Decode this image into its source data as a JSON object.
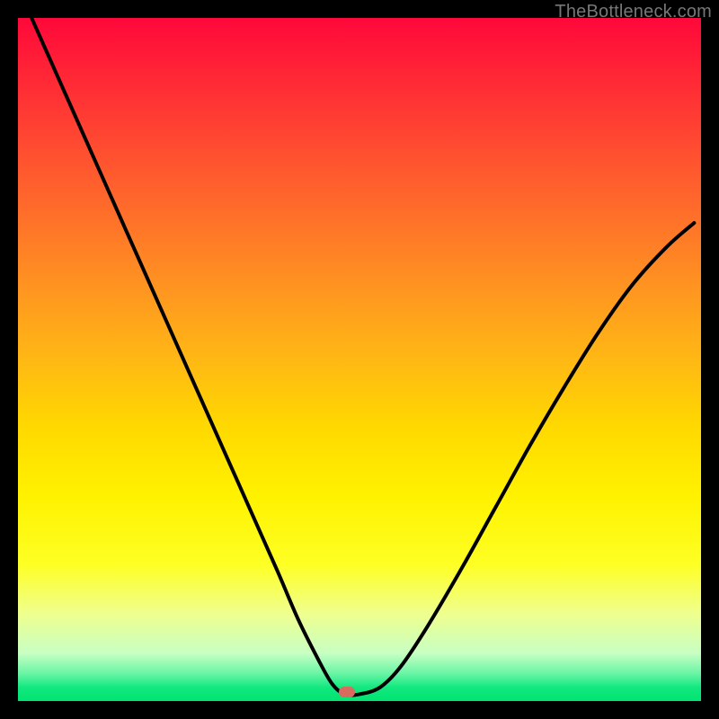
{
  "watermark": "TheBottleneck.com",
  "marker": {
    "x_frac": 0.481,
    "y_frac": 0.987
  },
  "chart_data": {
    "type": "line",
    "title": "",
    "xlabel": "",
    "ylabel": "",
    "xlim": [
      0,
      1
    ],
    "ylim": [
      0,
      1
    ],
    "series": [
      {
        "name": "bottleneck-curve",
        "x": [
          0.02,
          0.06,
          0.1,
          0.14,
          0.18,
          0.22,
          0.26,
          0.3,
          0.34,
          0.38,
          0.41,
          0.44,
          0.46,
          0.478,
          0.5,
          0.53,
          0.56,
          0.6,
          0.65,
          0.7,
          0.75,
          0.8,
          0.85,
          0.9,
          0.95,
          0.99
        ],
        "y": [
          1.0,
          0.91,
          0.82,
          0.73,
          0.64,
          0.55,
          0.46,
          0.37,
          0.28,
          0.19,
          0.12,
          0.06,
          0.025,
          0.01,
          0.01,
          0.02,
          0.05,
          0.11,
          0.195,
          0.285,
          0.375,
          0.46,
          0.54,
          0.61,
          0.665,
          0.7
        ]
      }
    ],
    "annotations": [
      {
        "type": "marker",
        "x": 0.481,
        "y": 0.013,
        "label": "optimal-point"
      }
    ],
    "background_gradient": {
      "direction": "vertical",
      "stops": [
        {
          "pos": 0.0,
          "color": "#ff083a"
        },
        {
          "pos": 0.5,
          "color": "#ffb814"
        },
        {
          "pos": 0.8,
          "color": "#feff24"
        },
        {
          "pos": 1.0,
          "color": "#00e472"
        }
      ]
    }
  }
}
